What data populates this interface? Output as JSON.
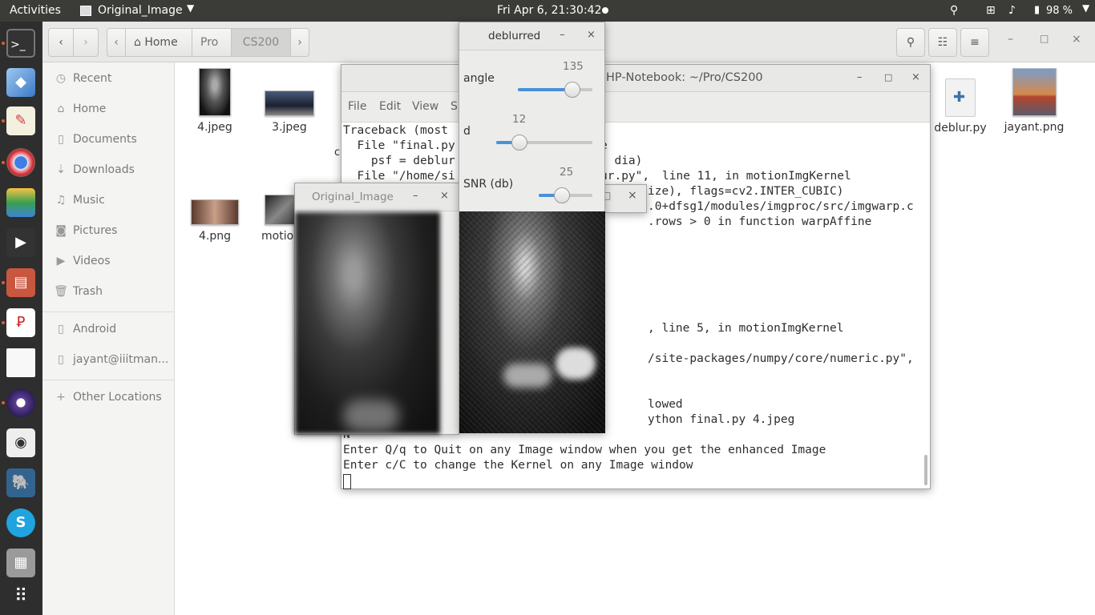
{
  "topbar": {
    "activities": "Activities",
    "app_name": "Original_Image",
    "clock": "Fri Apr  6, 21:30:42",
    "battery": "98 %"
  },
  "launcher": {
    "items": [
      "terminal-icon",
      "cube-icon",
      "text-editor-icon",
      "chrome-icon",
      "layers-icon",
      "video-icon",
      "files-icon",
      "pdf-icon",
      "document-icon",
      "eclipse-icon",
      "speaker-icon",
      "postgres-icon",
      "skype-icon",
      "usb-icon",
      "app-grid-icon"
    ]
  },
  "files": {
    "breadcrumbs": [
      "Home",
      "Pro",
      "CS200"
    ],
    "sidebar": {
      "places": [
        "Recent",
        "Home",
        "Documents",
        "Downloads",
        "Music",
        "Pictures",
        "Videos",
        "Trash"
      ],
      "devices": [
        "Android",
        "jayant@iiitman..."
      ],
      "other": "Other Locations"
    },
    "items": [
      {
        "name": "4.jpeg"
      },
      {
        "name": "3.jpeg"
      },
      {
        "name": "deblur.py"
      },
      {
        "name": "jayant.png"
      },
      {
        "name": "4.png"
      },
      {
        "name": "motion"
      },
      {
        "name": "c"
      }
    ]
  },
  "terminal": {
    "title": "HP-Notebook: ~/Pro/CS200",
    "menu": [
      "File",
      "Edit",
      "View",
      "S"
    ],
    "lines": [
      {
        "text": "Traceback (most"
      },
      {
        "text": "  File \"final.py"
      },
      {
        "text": "    psf = deblur"
      },
      {
        "text": "  File \"/home/si"
      },
      {
        "text": "line 11, in motionImgKernel"
      },
      {
        "text": "ize), flags=cv2.INTER_CUBIC)"
      },
      {
        "text": ".0+dfsg1/modules/imgproc/src/imgwarp.c"
      },
      {
        "text": ".rows > 0 in function warpAffine"
      },
      {
        "text": ", line 5, in motionImgKernel"
      },
      {
        "text": "/site-packages/numpy/core/numeric.py\","
      },
      {
        "text": "lowed"
      },
      {
        "text": "ython final.py 4.jpeg"
      },
      {
        "text": "N"
      },
      {
        "text": "Enter Q/q to Quit on any Image window when you get the enhanced Image"
      },
      {
        "text": "Enter c/C to change the Kernel on any Image window"
      }
    ],
    "frag_e": "e",
    "frag_dia": ", dia)",
    "frag_ur": "ur.py\", "
  },
  "original_window": {
    "title": "Original_Image"
  },
  "deblurred_window": {
    "title": "deblurred",
    "sliders": [
      {
        "label": "angle",
        "value": "135",
        "fraction": 0.73
      },
      {
        "label": "d",
        "value": "12",
        "fraction": 0.24
      },
      {
        "label": "SNR (db)",
        "value": "25",
        "fraction": 0.43
      }
    ]
  }
}
